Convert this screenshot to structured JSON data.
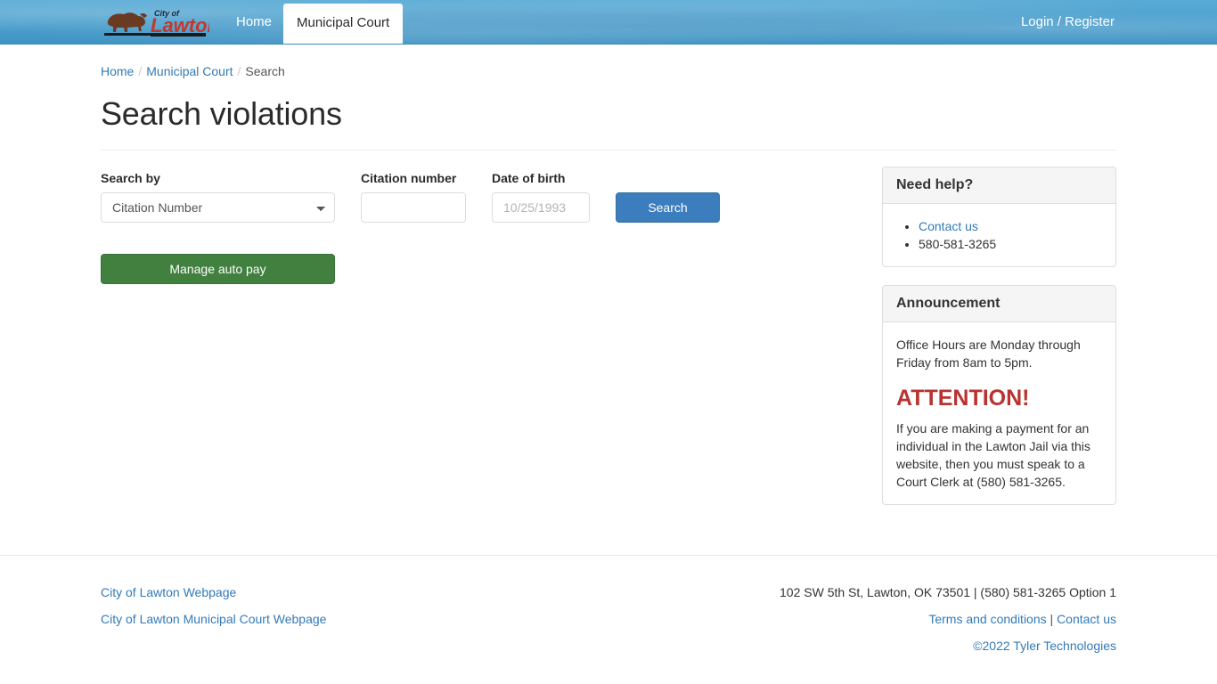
{
  "navbar": {
    "brand": {
      "icon": "bison-logo-icon",
      "line1": "City of",
      "line2": "Lawton"
    },
    "home_label": "Home",
    "active_tab_label": "Municipal Court",
    "login_label": "Login / Register"
  },
  "breadcrumb": {
    "home": "Home",
    "municipal_court": "Municipal Court",
    "current": "Search",
    "separator": "/"
  },
  "page": {
    "title": "Search violations"
  },
  "form": {
    "search_by": {
      "label": "Search by",
      "selected": "Citation Number",
      "options": [
        "Citation Number"
      ]
    },
    "citation_number": {
      "label": "Citation number",
      "value": "",
      "placeholder": ""
    },
    "date_of_birth": {
      "label": "Date of birth",
      "value": "",
      "placeholder": "10/25/1993"
    },
    "search_button": "Search",
    "manage_auto_pay_button": "Manage auto pay"
  },
  "sidebar": {
    "need_help": {
      "title": "Need help?",
      "items": [
        {
          "text": "Contact us",
          "is_link": true
        },
        {
          "text": "580-581-3265",
          "is_link": false
        }
      ]
    },
    "announcement": {
      "title": "Announcement",
      "office_hours": "Office Hours are Monday through Friday from 8am to 5pm.",
      "attention_heading": "ATTENTION!",
      "attention_body": "If you are making a payment for an individual in the Lawton Jail via this website, then you must speak to a Court Clerk at (580) 581-3265."
    }
  },
  "footer": {
    "links": [
      "City of Lawton Webpage",
      "City of Lawton Municipal Court Webpage"
    ],
    "address": "102 SW 5th St, Lawton, OK 73501 | (580) 581-3265 Option 1",
    "terms": "Terms and conditions",
    "pipe": "|",
    "contact": "Contact us",
    "copyright": "©2022 Tyler Technologies"
  },
  "colors": {
    "navbar_blue": "#4fa3d1",
    "link_blue": "#337ab7",
    "search_button": "#3b7dbd",
    "autopay_green": "#41803f",
    "attention_red": "#b9322f",
    "logo_red": "#c0392b"
  }
}
